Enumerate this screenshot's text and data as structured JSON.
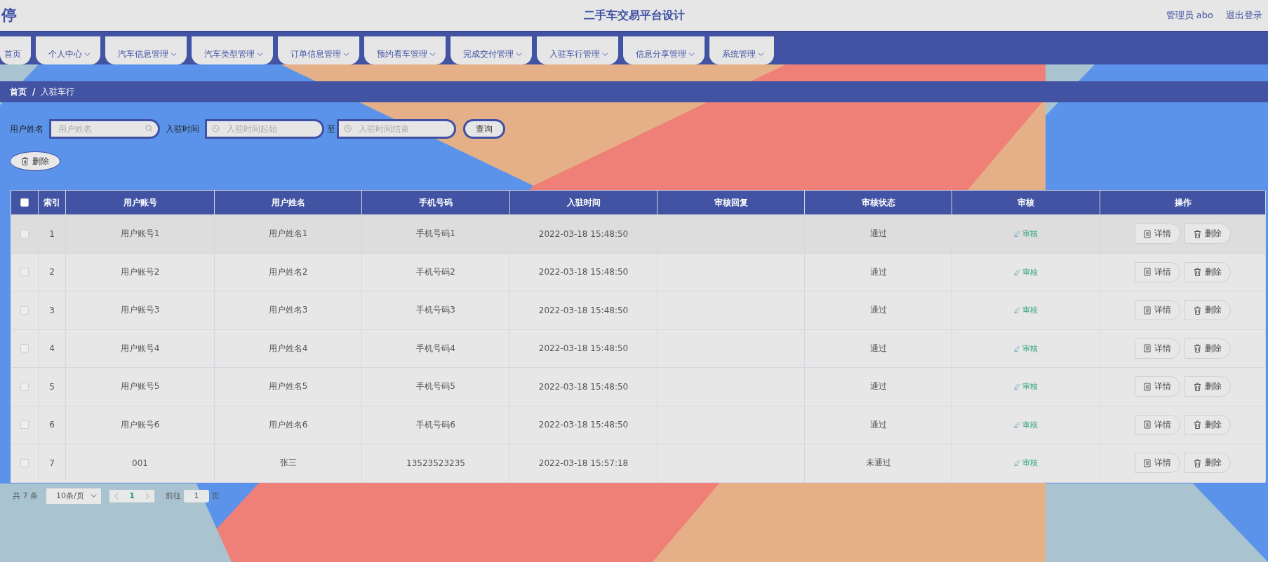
{
  "header": {
    "logo": "停",
    "title": "二手车交易平台设计",
    "user": "管理员 abo",
    "logout": "退出登录"
  },
  "nav": [
    {
      "label": "首页",
      "dropdown": false
    },
    {
      "label": "个人中心",
      "dropdown": true
    },
    {
      "label": "汽车信息管理",
      "dropdown": true
    },
    {
      "label": "汽车类型管理",
      "dropdown": true
    },
    {
      "label": "订单信息管理",
      "dropdown": true
    },
    {
      "label": "预约看车管理",
      "dropdown": true
    },
    {
      "label": "完成交付管理",
      "dropdown": true
    },
    {
      "label": "入驻车行管理",
      "dropdown": true
    },
    {
      "label": "信息分享管理",
      "dropdown": true
    },
    {
      "label": "系统管理",
      "dropdown": true
    }
  ],
  "breadcrumb": [
    "首页",
    "入驻车行"
  ],
  "breadcrumb_separator": "/",
  "search": {
    "name_label": "用户姓名",
    "name_placeholder": "用户姓名",
    "time_label": "入驻时间",
    "start_placeholder": "入驻时间起始",
    "to": "至",
    "end_placeholder": "入驻时间结束",
    "query_button": "查询"
  },
  "delete_button": "删除",
  "table": {
    "header_checked": false,
    "columns": [
      "索引",
      "用户账号",
      "用户姓名",
      "手机号码",
      "入驻时间",
      "审核回复",
      "审核状态",
      "审核",
      "操作"
    ],
    "rows": [
      {
        "checked": false,
        "index": "1",
        "account": "用户账号1",
        "name": "用户姓名1",
        "phone": "手机号码1",
        "time": "2022-03-18 15:48:50",
        "reply": "",
        "status": "通过",
        "review": "审核",
        "actions": [
          "详情",
          "删除"
        ]
      },
      {
        "checked": false,
        "index": "2",
        "account": "用户账号2",
        "name": "用户姓名2",
        "phone": "手机号码2",
        "time": "2022-03-18 15:48:50",
        "reply": "",
        "status": "通过",
        "review": "审核",
        "actions": [
          "详情",
          "删除"
        ]
      },
      {
        "checked": false,
        "index": "3",
        "account": "用户账号3",
        "name": "用户姓名3",
        "phone": "手机号码3",
        "time": "2022-03-18 15:48:50",
        "reply": "",
        "status": "通过",
        "review": "审核",
        "actions": [
          "详情",
          "删除"
        ]
      },
      {
        "checked": false,
        "index": "4",
        "account": "用户账号4",
        "name": "用户姓名4",
        "phone": "手机号码4",
        "time": "2022-03-18 15:48:50",
        "reply": "",
        "status": "通过",
        "review": "审核",
        "actions": [
          "详情",
          "删除"
        ]
      },
      {
        "checked": false,
        "index": "5",
        "account": "用户账号5",
        "name": "用户姓名5",
        "phone": "手机号码5",
        "time": "2022-03-18 15:48:50",
        "reply": "",
        "status": "通过",
        "review": "审核",
        "actions": [
          "详情",
          "删除"
        ]
      },
      {
        "checked": false,
        "index": "6",
        "account": "用户账号6",
        "name": "用户姓名6",
        "phone": "手机号码6",
        "time": "2022-03-18 15:48:50",
        "reply": "",
        "status": "通过",
        "review": "审核",
        "actions": [
          "详情",
          "删除"
        ]
      },
      {
        "checked": false,
        "index": "7",
        "account": "001",
        "name": "张三",
        "phone": "13523523235",
        "time": "2022-03-18 15:57:18",
        "reply": "",
        "status": "未通过",
        "review": "审核",
        "actions": [
          "详情",
          "删除"
        ]
      }
    ]
  },
  "pagination": {
    "total": "共 7 条",
    "page_size": "10条/页",
    "pages": [
      {
        "label": "1",
        "selected": true
      }
    ],
    "goto": "前往",
    "goto_value": "1",
    "page_unit": "页"
  }
}
